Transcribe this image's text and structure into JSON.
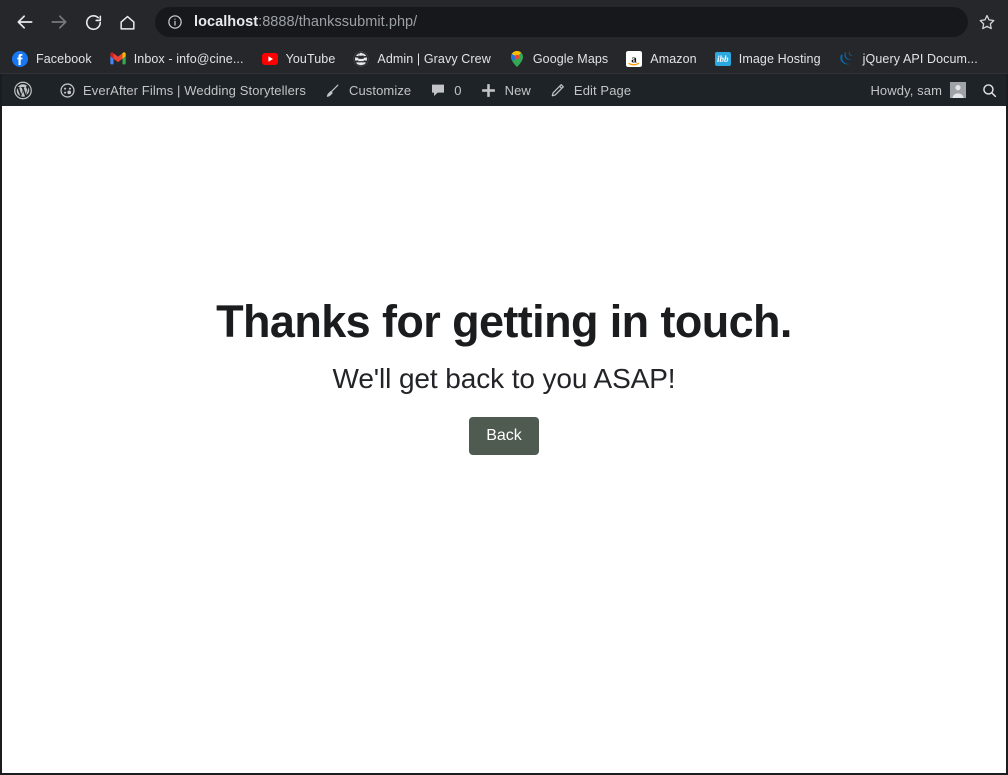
{
  "browser": {
    "nav": {
      "back_label": "Back",
      "forward_label": "Forward",
      "reload_label": "Reload",
      "home_label": "Home",
      "bookmark_label": "Bookmark this tab"
    },
    "omnibox": {
      "host": "localhost",
      "path": ":8888/thankssubmit.php/",
      "full_url": "localhost:8888/thankssubmit.php/",
      "security_icon": "info-circle-icon"
    },
    "bookmarks": [
      {
        "label": "Facebook",
        "icon": "facebook-icon"
      },
      {
        "label": "Inbox - info@cine...",
        "icon": "gmail-icon"
      },
      {
        "label": "YouTube",
        "icon": "youtube-icon"
      },
      {
        "label": "Admin | Gravy Crew",
        "icon": "globe-icon"
      },
      {
        "label": "Google Maps",
        "icon": "google-maps-icon"
      },
      {
        "label": "Amazon",
        "icon": "amazon-icon"
      },
      {
        "label": "Image Hosting",
        "icon": "ibb-icon",
        "icon_text": "ibb"
      },
      {
        "label": "jQuery API Docum...",
        "icon": "jquery-icon"
      }
    ]
  },
  "wpbar": {
    "logo_label": "About WordPress",
    "site_name": "EverAfter Films | Wedding Storytellers",
    "customize_label": "Customize",
    "comments_count": "0",
    "new_label": "New",
    "edit_page_label": "Edit Page",
    "howdy_label": "Howdy, sam",
    "search_label": "Search"
  },
  "page": {
    "headline": "Thanks for getting in touch.",
    "subline": "We'll get back to you ASAP!",
    "back_button": "Back"
  },
  "colors": {
    "toolbar_bg": "#26272B",
    "omnibox_bg": "#17181B",
    "wpbar_bg": "#1D2327",
    "page_bg": "#ffffff",
    "button_bg": "#4F5A50",
    "heading_text": "#1B1C1E"
  }
}
